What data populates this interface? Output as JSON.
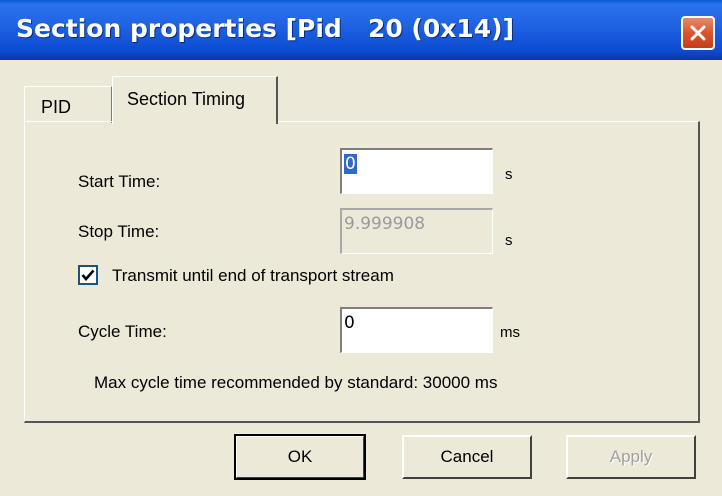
{
  "window": {
    "title": "Section properties [Pid   20 (0x14)]"
  },
  "tabs": [
    {
      "label": "PID",
      "selected": false
    },
    {
      "label": "Section Timing",
      "selected": true
    }
  ],
  "form": {
    "start_time": {
      "label": "Start Time:",
      "value": "0",
      "unit": "s"
    },
    "stop_time": {
      "label": "Stop Time:",
      "value": "9.999908",
      "unit": "s",
      "disabled": true
    },
    "transmit_checkbox": {
      "label": "Transmit until end of transport stream",
      "checked": true
    },
    "cycle_time": {
      "label": "Cycle Time:",
      "value": "0",
      "unit": "ms"
    },
    "recommendation_text": "Max cycle time recommended by standard: 30000 ms"
  },
  "buttons": {
    "ok": "OK",
    "cancel": "Cancel",
    "apply": "Apply"
  },
  "colors": {
    "titlebar": "#1d5fe0",
    "close_button": "#d8562f",
    "dialog_bg": "#ece9d8",
    "selection": "#316ac5"
  },
  "icons": {
    "close": "close-icon",
    "check": "checkmark-icon"
  }
}
